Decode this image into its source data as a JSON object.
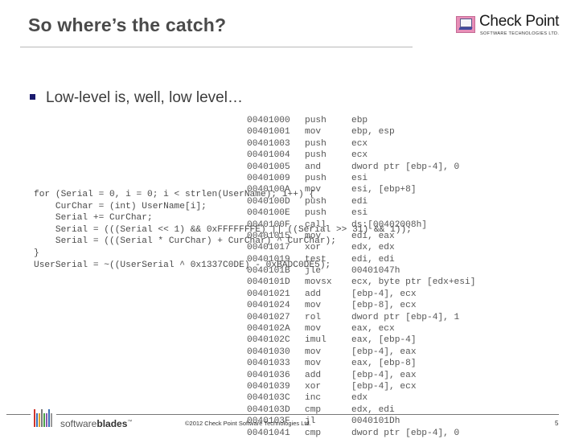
{
  "slide": {
    "title": "So where’s the catch?",
    "bullet": "Low-level is, well, low level…",
    "page_number": "5"
  },
  "logo": {
    "name": "Check Point",
    "tagline": "SOFTWARE TECHNOLOGIES LTD.",
    "icon": "computer-monitor-icon"
  },
  "assembly": [
    {
      "addr": "00401000",
      "op": "push",
      "arg": "ebp"
    },
    {
      "addr": "00401001",
      "op": "mov",
      "arg": "ebp, esp"
    },
    {
      "addr": "00401003",
      "op": "push",
      "arg": "ecx"
    },
    {
      "addr": "00401004",
      "op": "push",
      "arg": "ecx"
    },
    {
      "addr": "00401005",
      "op": "and",
      "arg": "dword ptr [ebp-4], 0"
    },
    {
      "addr": "00401009",
      "op": "push",
      "arg": "esi"
    },
    {
      "addr": "0040100A",
      "op": "mov",
      "arg": "esi, [ebp+8]"
    },
    {
      "addr": "0040100D",
      "op": "push",
      "arg": "edi"
    },
    {
      "addr": "0040100E",
      "op": "push",
      "arg": "esi"
    },
    {
      "addr": "0040100F",
      "op": "call",
      "arg": "ds:[00402008h]"
    },
    {
      "addr": "00401015",
      "op": "mov",
      "arg": "edi, eax"
    },
    {
      "addr": "00401017",
      "op": "xor",
      "arg": "edx, edx"
    },
    {
      "addr": "00401019",
      "op": "test",
      "arg": "edi, edi"
    },
    {
      "addr": "0040101B",
      "op": "jle",
      "arg": "00401047h"
    },
    {
      "addr": "0040101D",
      "op": "movsx",
      "arg": "ecx, byte ptr [edx+esi]"
    },
    {
      "addr": "00401021",
      "op": "add",
      "arg": "[ebp-4], ecx"
    },
    {
      "addr": "00401024",
      "op": "mov",
      "arg": "[ebp-8], ecx"
    },
    {
      "addr": "00401027",
      "op": "rol",
      "arg": "dword ptr [ebp-4], 1"
    },
    {
      "addr": "0040102A",
      "op": "mov",
      "arg": "eax, ecx"
    },
    {
      "addr": "0040102C",
      "op": "imul",
      "arg": "eax, [ebp-4]"
    },
    {
      "addr": "00401030",
      "op": "mov",
      "arg": "[ebp-4], eax"
    },
    {
      "addr": "00401033",
      "op": "mov",
      "arg": "eax, [ebp-8]"
    },
    {
      "addr": "00401036",
      "op": "add",
      "arg": "[ebp-4], eax"
    },
    {
      "addr": "00401039",
      "op": "xor",
      "arg": "[ebp-4], ecx"
    },
    {
      "addr": "0040103C",
      "op": "inc",
      "arg": "edx"
    },
    {
      "addr": "0040103D",
      "op": "cmp",
      "arg": "edx, edi"
    },
    {
      "addr": "0040103F",
      "op": "jl",
      "arg": "0040101Dh"
    },
    {
      "addr": "00401041",
      "op": "cmp",
      "arg": "dword ptr [ebp-4], 0"
    }
  ],
  "source_code": [
    "for (Serial = 0, i = 0; i < strlen(UserName); i++) {",
    "    CurChar = (int) UserName[i];",
    "    Serial += CurChar;",
    "    Serial = (((Serial << 1) && 0xFFFFFFFE) || ((Serial >> 31) && 1));",
    "    Serial = (((Serial * CurChar) + CurChar) ^ CurChar);",
    "}",
    "UserSerial = ~((UserSerial ^ 0x1337C0DE) - 0xBADC0DE5);"
  ],
  "footer": {
    "brand_light": "software",
    "brand_bold": "blades",
    "brand_mark": "™",
    "copyright": "©2012 Check Point Software Technologies Ltd.",
    "blade_colors": [
      "#d0342c",
      "#3a6fb7",
      "#e0a12a",
      "#7a7a7a",
      "#4aa04a",
      "#8a5ab0",
      "#3a6fb7",
      "#999999"
    ]
  }
}
